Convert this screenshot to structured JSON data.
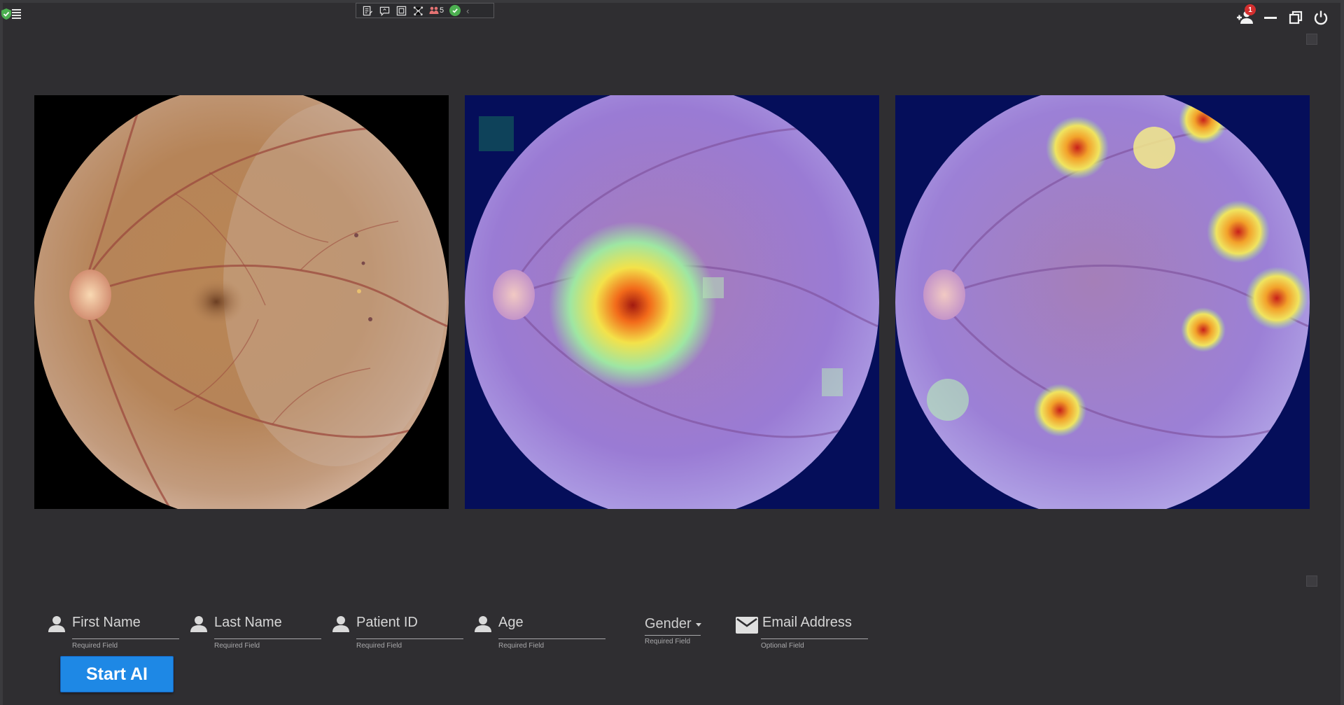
{
  "app": {
    "accent_color": "#1e88e5",
    "status_colors": {
      "shield": "#4caf50",
      "notification": "#d32f2f",
      "ok": "#4caf50"
    }
  },
  "toolbar": {
    "icons": [
      "list-edit-icon",
      "comment-icon",
      "frame-icon",
      "network-icon",
      "people-count-icon",
      "check-circle-icon",
      "chevron-left-icon"
    ],
    "people_count": "5"
  },
  "header_right": {
    "notification_count": "1",
    "icons": [
      "add-user-icon",
      "minimize-icon",
      "restore-icon",
      "power-icon"
    ]
  },
  "images": [
    {
      "name": "original-fundus-image",
      "overlay": "none"
    },
    {
      "name": "heatmap-overlay-1",
      "overlay": "attention-heatmap"
    },
    {
      "name": "heatmap-overlay-2",
      "overlay": "attention-heatmap"
    }
  ],
  "form": {
    "first_name": {
      "label": "First Name",
      "hint": "Required Field"
    },
    "last_name": {
      "label": "Last Name",
      "hint": "Required Field"
    },
    "patient_id": {
      "label": "Patient ID",
      "hint": "Required Field"
    },
    "age": {
      "label": "Age",
      "hint": "Required Field"
    },
    "gender": {
      "label": "Gender",
      "hint": "Required Field"
    },
    "email": {
      "label": "Email Address",
      "hint": "Optional Field"
    },
    "start_label": "Start AI"
  }
}
